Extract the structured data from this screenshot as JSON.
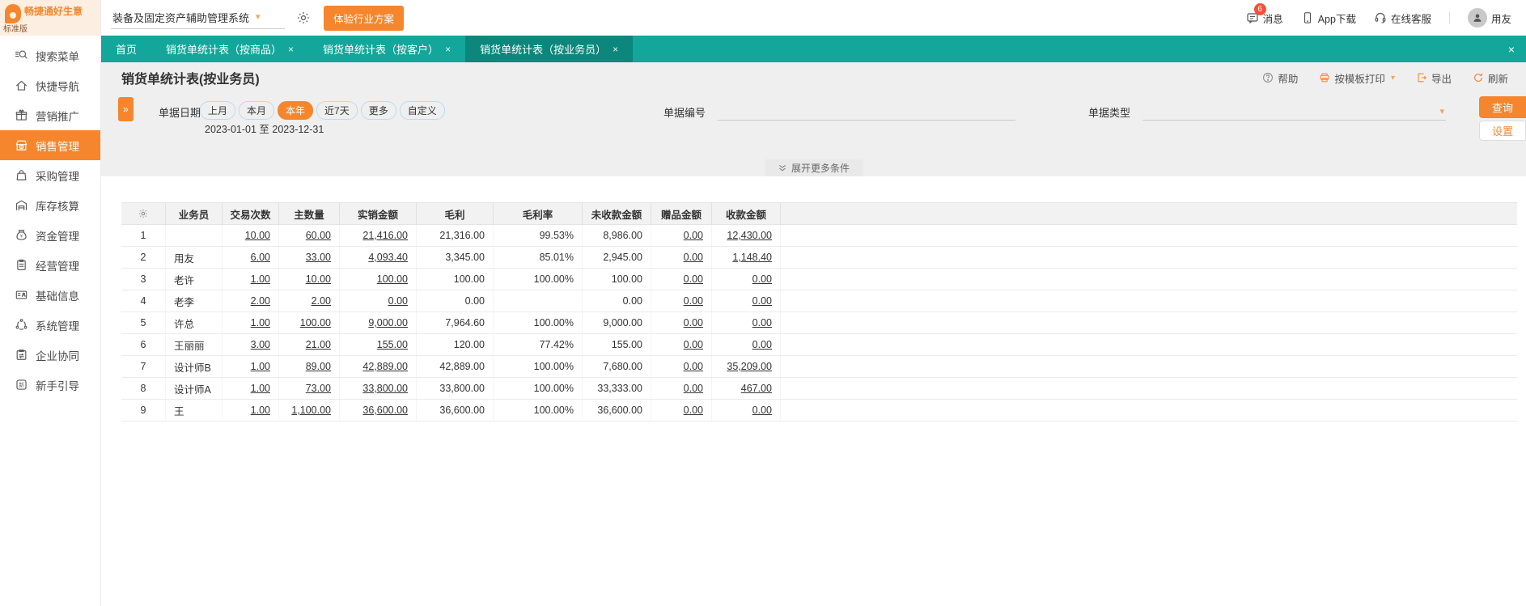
{
  "colors": {
    "teal": "#12a79a",
    "teal_dark": "#0b877b",
    "orange": "#f5862d",
    "badge_red": "#f5503a",
    "logo_bg": "#fceee1"
  },
  "brand": {
    "name": "畅捷通好生意",
    "edition": "标准版"
  },
  "header": {
    "system_select": "装备及固定资产辅助管理系统",
    "trial_button": "体验行业方案",
    "messages_label": "消息",
    "messages_badge": "6",
    "app_download_label": "App下载",
    "online_service_label": "在线客服",
    "user_name": "用友"
  },
  "sidebar": {
    "active_index": 3,
    "items": [
      {
        "id": "search",
        "label": "搜索菜单"
      },
      {
        "id": "home",
        "label": "快捷导航"
      },
      {
        "id": "gift",
        "label": "营销推广"
      },
      {
        "id": "sales",
        "label": "销售管理"
      },
      {
        "id": "purchase",
        "label": "采购管理"
      },
      {
        "id": "inventory",
        "label": "库存核算"
      },
      {
        "id": "funds",
        "label": "资金管理"
      },
      {
        "id": "operations",
        "label": "经营管理"
      },
      {
        "id": "baseinfo",
        "label": "基础信息"
      },
      {
        "id": "system",
        "label": "系统管理"
      },
      {
        "id": "collab",
        "label": "企业协同"
      },
      {
        "id": "guide",
        "label": "新手引导"
      }
    ]
  },
  "tabs": {
    "active_index": 3,
    "items": [
      {
        "label": "首页",
        "closable": false
      },
      {
        "label": "销货单统计表（按商品）",
        "closable": true
      },
      {
        "label": "销货单统计表（按客户）",
        "closable": true
      },
      {
        "label": "销货单统计表（按业务员）",
        "closable": true
      }
    ]
  },
  "page": {
    "title": "销货单统计表(按业务员)"
  },
  "toolbar": {
    "help": "帮助",
    "print": "按模板打印",
    "export": "导出",
    "refresh": "刷新"
  },
  "filters": {
    "date_label": "单据日期",
    "date_pills": [
      "上月",
      "本月",
      "本年",
      "近7天",
      "更多",
      "自定义"
    ],
    "active_pill_index": 2,
    "date_range": "2023-01-01 至 2023-12-31",
    "doc_no_label": "单据编号",
    "doc_type_label": "单据类型",
    "expand_more": "展开更多条件",
    "query_button": "查询",
    "settings_button": "设置"
  },
  "table": {
    "columns": [
      "业务员",
      "交易次数",
      "主数量",
      "实销金额",
      "毛利",
      "毛利率",
      "未收款金额",
      "赠品金额",
      "收款金额"
    ],
    "link_value_indices": [
      0,
      1,
      2,
      6,
      7
    ],
    "rows": [
      {
        "num": "1",
        "name": "",
        "values": [
          "10.00",
          "60.00",
          "21,416.00",
          "21,316.00",
          "99.53%",
          "8,986.00",
          "0.00",
          "12,430.00"
        ]
      },
      {
        "num": "2",
        "name": "用友",
        "values": [
          "6.00",
          "33.00",
          "4,093.40",
          "3,345.00",
          "85.01%",
          "2,945.00",
          "0.00",
          "1,148.40"
        ]
      },
      {
        "num": "3",
        "name": "老许",
        "values": [
          "1.00",
          "10.00",
          "100.00",
          "100.00",
          "100.00%",
          "100.00",
          "0.00",
          "0.00"
        ]
      },
      {
        "num": "4",
        "name": "老李",
        "values": [
          "2.00",
          "2.00",
          "0.00",
          "0.00",
          "",
          "0.00",
          "0.00",
          "0.00"
        ]
      },
      {
        "num": "5",
        "name": "许总",
        "values": [
          "1.00",
          "100.00",
          "9,000.00",
          "7,964.60",
          "100.00%",
          "9,000.00",
          "0.00",
          "0.00"
        ]
      },
      {
        "num": "6",
        "name": "王丽丽",
        "values": [
          "3.00",
          "21.00",
          "155.00",
          "120.00",
          "77.42%",
          "155.00",
          "0.00",
          "0.00"
        ]
      },
      {
        "num": "7",
        "name": "设计师B",
        "values": [
          "1.00",
          "89.00",
          "42,889.00",
          "42,889.00",
          "100.00%",
          "7,680.00",
          "0.00",
          "35,209.00"
        ]
      },
      {
        "num": "8",
        "name": "设计师A",
        "values": [
          "1.00",
          "73.00",
          "33,800.00",
          "33,800.00",
          "100.00%",
          "33,333.00",
          "0.00",
          "467.00"
        ]
      },
      {
        "num": "9",
        "name": "王",
        "values": [
          "1.00",
          "1,100.00",
          "36,600.00",
          "36,600.00",
          "100.00%",
          "36,600.00",
          "0.00",
          "0.00"
        ]
      }
    ]
  }
}
